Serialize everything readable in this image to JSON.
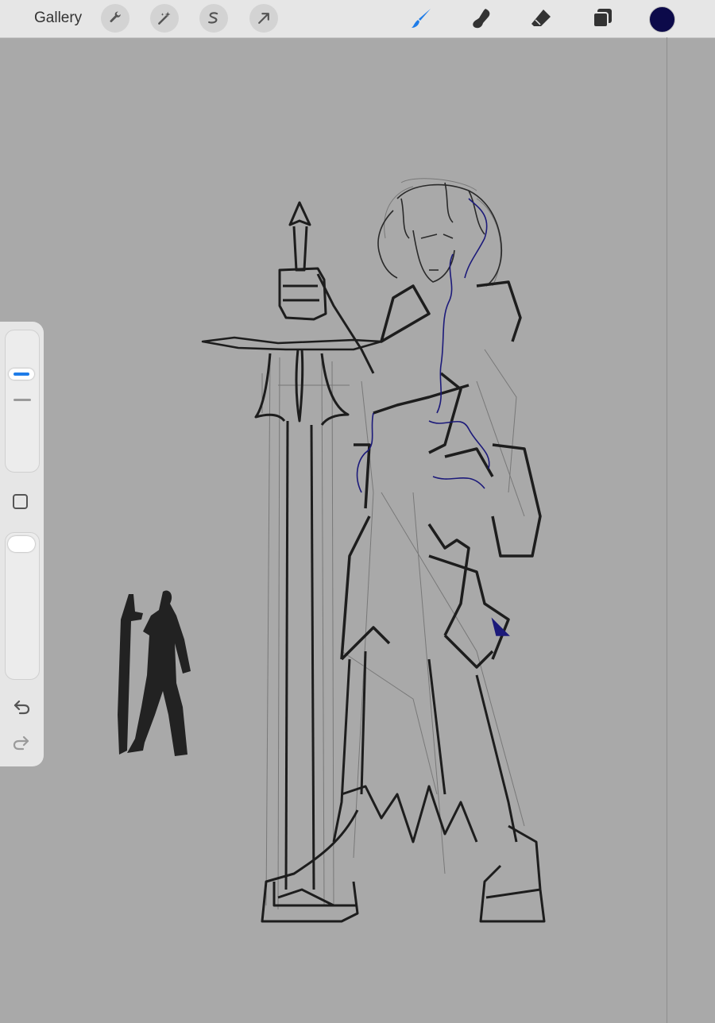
{
  "app": {
    "gallery_label": "Gallery"
  },
  "toolbar_left": [
    {
      "name": "actions-wrench-icon"
    },
    {
      "name": "adjustments-wand-icon"
    },
    {
      "name": "selection-s-icon"
    },
    {
      "name": "transform-arrow-icon"
    }
  ],
  "toolbar_right": [
    {
      "name": "brush-icon",
      "active": true
    },
    {
      "name": "smudge-icon",
      "active": false
    },
    {
      "name": "eraser-icon",
      "active": false
    },
    {
      "name": "layers-icon",
      "active": false
    }
  ],
  "colors": {
    "accent": "#1e7ce8",
    "current_color": "#0c0a4a",
    "ink": "#1d1d1d",
    "blue_ink": "#1c1a7a",
    "canvas": "#a9a9a9"
  },
  "sidebar": {
    "brush_size_level": 0.72,
    "opacity_level": 1.0,
    "undo_icon": "undo-arrow-icon",
    "redo_icon": "redo-arrow-icon",
    "modify_icon": "square-modify-icon"
  }
}
